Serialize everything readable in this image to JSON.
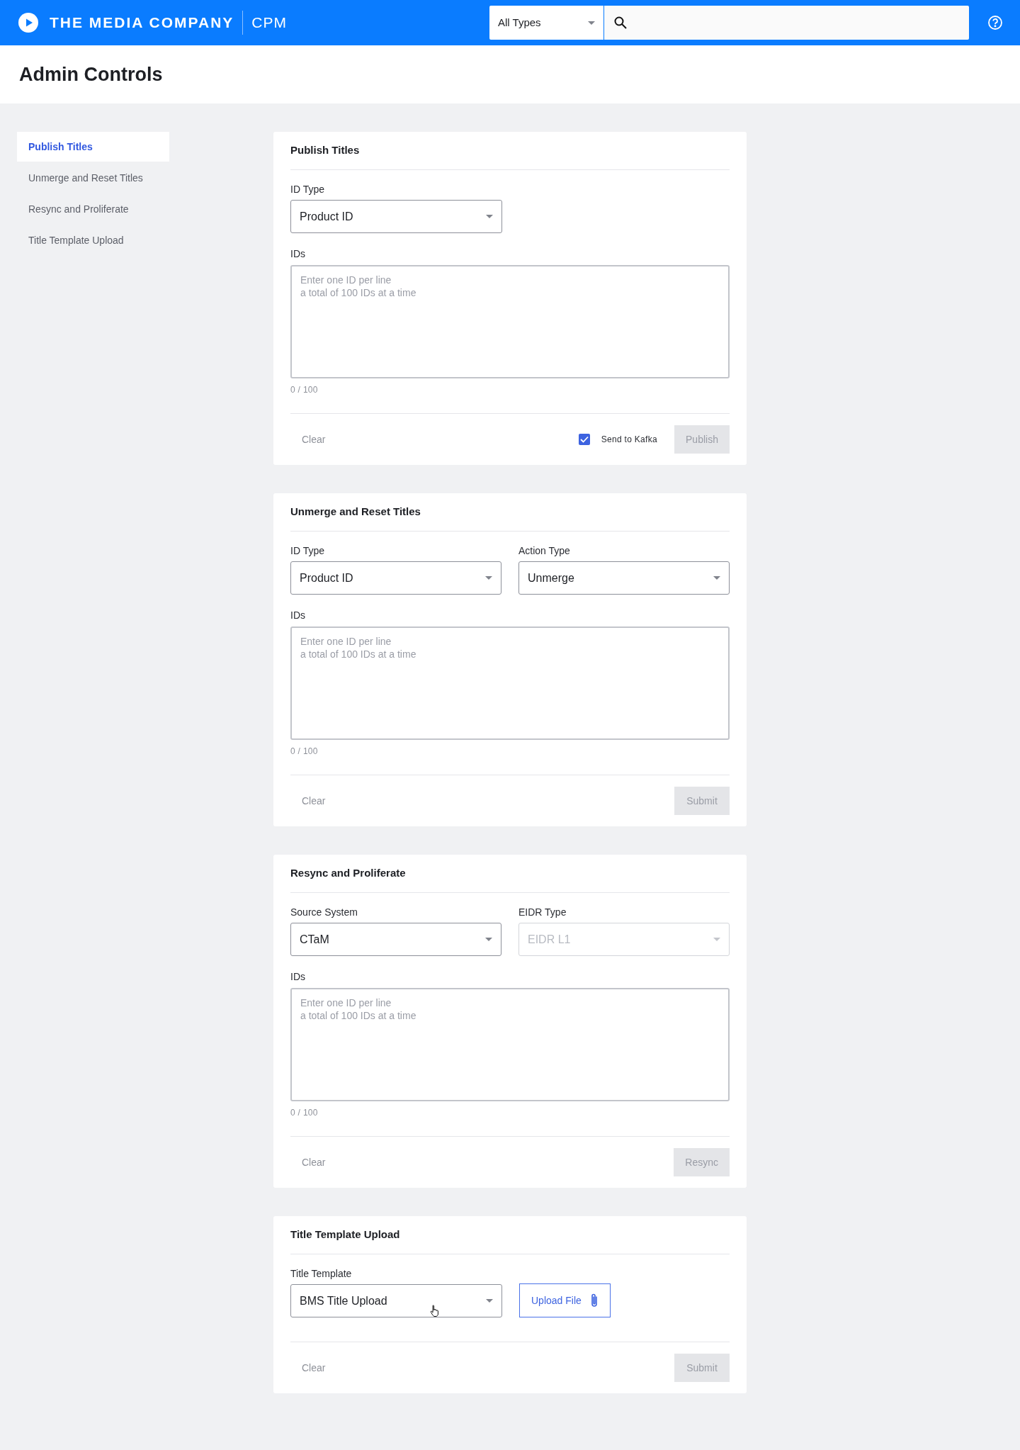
{
  "header": {
    "brand": "THE MEDIA COMPANY",
    "product": "CPM",
    "type_filter": {
      "value": "All Types"
    }
  },
  "page_title": "Admin Controls",
  "sidebar": {
    "items": [
      {
        "label": "Publish Titles",
        "selected": true
      },
      {
        "label": "Unmerge and Reset Titles",
        "selected": false
      },
      {
        "label": "Resync and Proliferate",
        "selected": false
      },
      {
        "label": "Title Template Upload",
        "selected": false
      }
    ]
  },
  "cards": [
    {
      "title": "Publish Titles",
      "fields": [
        {
          "kind": "select",
          "label": "ID Type",
          "value": "Product ID",
          "disabled": false
        },
        {
          "kind": "textarea",
          "label": "IDs",
          "placeholder": "Enter one ID per line\na total of 100 IDs at a time",
          "counter": "0 / 100"
        }
      ],
      "footer": {
        "clear": "Clear",
        "checkbox": {
          "label": "Send to Kafka",
          "checked": true
        },
        "submit": {
          "label": "Publish",
          "disabled": true
        }
      }
    },
    {
      "title": "Unmerge and Reset Titles",
      "fields": [
        {
          "kind": "select",
          "label": "ID Type",
          "value": "Product ID",
          "disabled": false
        },
        {
          "kind": "select",
          "label": "Action Type",
          "value": "Unmerge",
          "disabled": false
        },
        {
          "kind": "textarea",
          "label": "IDs",
          "placeholder": "Enter one ID per line\na total of 100 IDs at a time",
          "counter": "0 / 100"
        }
      ],
      "footer": {
        "clear": "Clear",
        "submit": {
          "label": "Submit",
          "disabled": true
        }
      }
    },
    {
      "title": "Resync and Proliferate",
      "fields": [
        {
          "kind": "select",
          "label": "Source System",
          "value": "CTaM",
          "disabled": false
        },
        {
          "kind": "select",
          "label": "EIDR Type",
          "value": "EIDR L1",
          "disabled": true
        },
        {
          "kind": "textarea",
          "label": "IDs",
          "placeholder": "Enter one ID per line\na total of 100 IDs at a time",
          "counter": "0 / 100"
        }
      ],
      "footer": {
        "clear": "Clear",
        "submit": {
          "label": "Resync",
          "disabled": true
        }
      }
    },
    {
      "title": "Title Template Upload",
      "fields": [
        {
          "kind": "select",
          "label": "Title Template",
          "value": "BMS Title Upload",
          "disabled": false,
          "hovered": true
        },
        {
          "kind": "upload",
          "label": "Upload File"
        }
      ],
      "footer": {
        "clear": "Clear",
        "submit": {
          "label": "Submit",
          "disabled": true
        }
      }
    }
  ]
}
